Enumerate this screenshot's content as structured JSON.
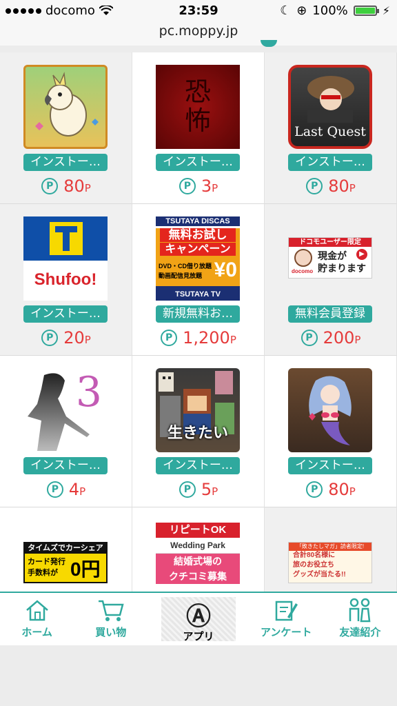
{
  "status": {
    "carrier": "docomo",
    "time": "23:59",
    "battery": "100%"
  },
  "browser": {
    "url": "pc.moppy.jp"
  },
  "items": [
    {
      "label": "インストー…",
      "points": "80",
      "unit": "P",
      "coin": "P",
      "thumb": "cockatoo"
    },
    {
      "label": "インストー…",
      "points": "3",
      "unit": "P",
      "coin": "P",
      "thumb": "horror",
      "thumb_text": "恐\n怖"
    },
    {
      "label": "インストー…",
      "points": "80",
      "unit": "P",
      "coin": "P",
      "thumb": "lastquest",
      "thumb_text": "Last Quest"
    },
    {
      "label": "インストー…",
      "points": "20",
      "unit": "P",
      "coin": "P",
      "thumb": "shufoo",
      "thumb_text": "Shufoo!"
    },
    {
      "label": "新規無料お…",
      "points": "1,200",
      "unit": "P",
      "coin": "P",
      "thumb": "tsutaya",
      "thumb_text": [
        "TSUTAYA DISCAS",
        "無料お試し",
        "キャンペーン",
        "DVD・CD借り放題",
        "動画配信見放題",
        "¥0",
        "TSUTAYA TV"
      ]
    },
    {
      "label": "無料会員登録",
      "points": "200",
      "unit": "P",
      "coin": "P",
      "thumb": "docomo",
      "thumb_text": [
        "ドコモユーザー限定",
        "現金が",
        "貯まります",
        "docomo"
      ]
    },
    {
      "label": "インストー…",
      "points": "4",
      "unit": "P",
      "coin": "P",
      "thumb": "silhouette",
      "thumb_text": "3"
    },
    {
      "label": "インストー…",
      "points": "5",
      "unit": "P",
      "coin": "P",
      "thumb": "pixel",
      "thumb_text": "生きたい"
    },
    {
      "label": "インストー…",
      "points": "80",
      "unit": "P",
      "coin": "P",
      "thumb": "mermaid"
    },
    {
      "thumb": "times",
      "thumb_text": [
        "タイムズでカーシェア",
        "カード発行",
        "手数料が",
        "0円"
      ]
    },
    {
      "thumb": "wedding",
      "thumb_text": [
        "リピートOK",
        "Wedding Park",
        "結婚式場の",
        "クチコミ募集"
      ]
    },
    {
      "thumb": "tameshi",
      "thumb_text": [
        "「敗きたしマガ」読者限定!",
        "合計80名様に",
        "旅のお役立ち",
        "グッズが当たる!!"
      ]
    }
  ],
  "nav": [
    {
      "label": "ホーム",
      "icon": "home-icon"
    },
    {
      "label": "買い物",
      "icon": "cart-icon"
    },
    {
      "label": "アプリ",
      "icon": "app-icon",
      "glyph": "Ⓐ"
    },
    {
      "label": "アンケート",
      "icon": "survey-icon"
    },
    {
      "label": "友達紹介",
      "icon": "friends-icon"
    }
  ],
  "colors": {
    "accent": "#2fa99e",
    "points": "#e53b3b"
  }
}
